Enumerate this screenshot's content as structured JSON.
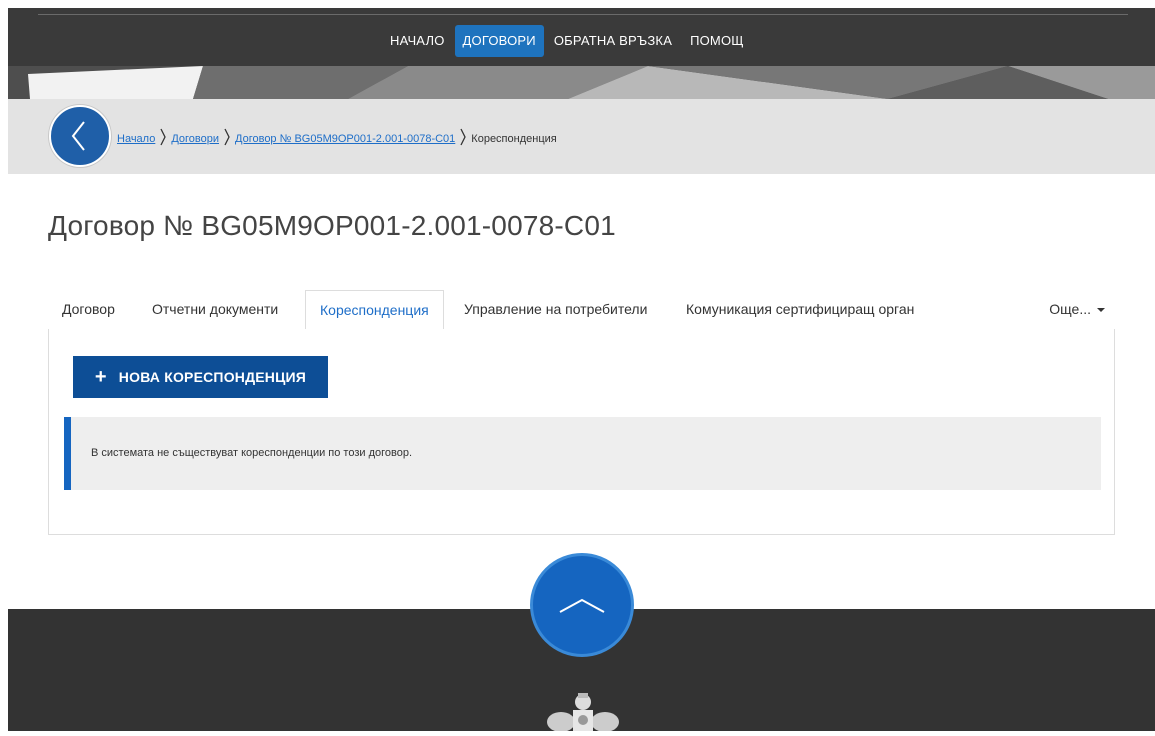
{
  "nav": {
    "items": [
      {
        "label": "НАЧАЛО",
        "active": false
      },
      {
        "label": "ДОГОВОРИ",
        "active": true
      },
      {
        "label": "ОБРАТНА ВРЪЗКА",
        "active": false
      },
      {
        "label": "ПОМОЩ",
        "active": false
      }
    ]
  },
  "breadcrumb": {
    "home": "Начало",
    "contracts": "Договори",
    "contract": "Договор № BG05M9OP001-2.001-0078-C01",
    "current": "Кореспонденция"
  },
  "page": {
    "title": "Договор № BG05M9OP001-2.001-0078-C01"
  },
  "tabs": {
    "contract": "Договор",
    "reports": "Отчетни документи",
    "correspondence": "Кореспонденция",
    "users": "Управление на потребители",
    "certifying": "Комуникация сертифициращ орган",
    "more": "Още..."
  },
  "panel": {
    "new_button": "НОВА КОРЕСПОНДЕНЦИЯ",
    "empty_notice": "В системата не съществуват кореспонденции по този договор."
  },
  "colors": {
    "accent": "#1e73be",
    "button": "#0d4e96",
    "header": "#3a3a3a",
    "footer": "#333333"
  }
}
